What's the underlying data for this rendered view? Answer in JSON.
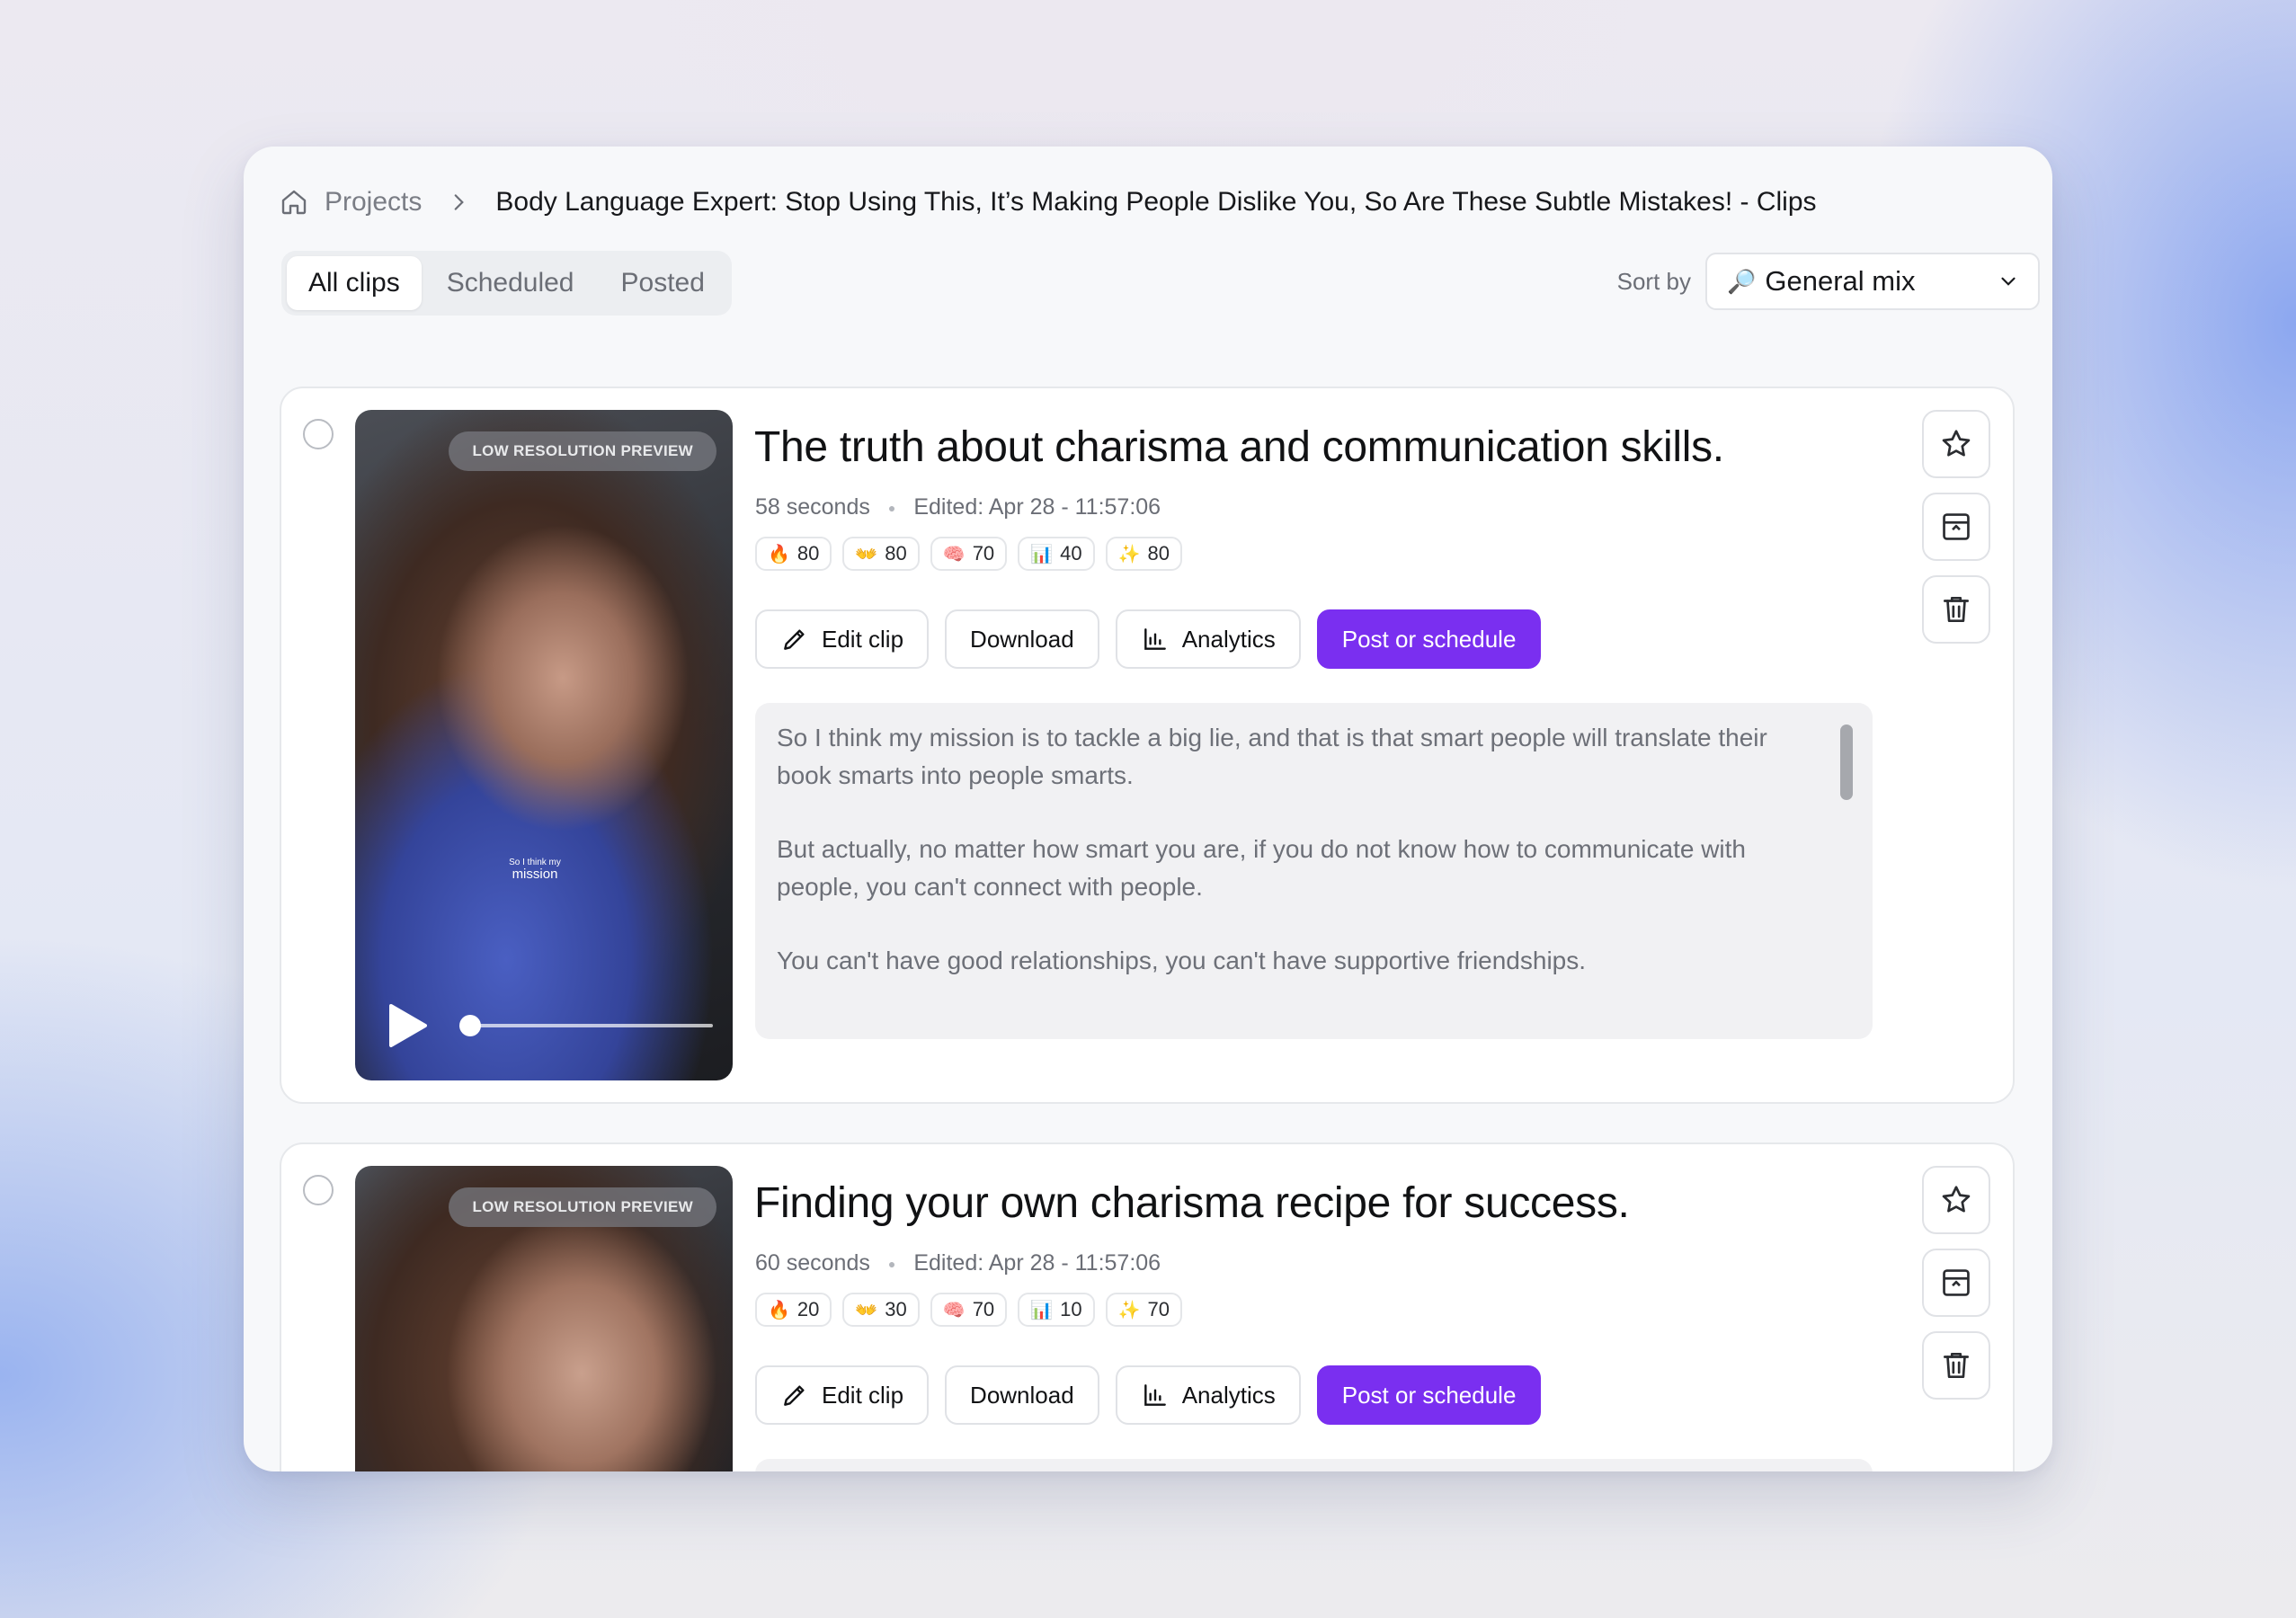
{
  "breadcrumb": {
    "home_icon": "home-icon",
    "projects": "Projects",
    "current": "Body Language Expert: Stop Using This, It’s Making People Dislike You, So Are These Subtle Mistakes! - Clips"
  },
  "tabs": [
    {
      "label": "All clips",
      "active": true
    },
    {
      "label": "Scheduled",
      "active": false
    },
    {
      "label": "Posted",
      "active": false
    }
  ],
  "sort": {
    "label": "Sort by",
    "icon": "🔎",
    "value": "General mix"
  },
  "accent_color": "#7a2ff0",
  "actions": {
    "edit": "Edit clip",
    "download": "Download",
    "analytics": "Analytics",
    "post": "Post or schedule"
  },
  "clips": [
    {
      "title": "The truth about charisma and communication skills.",
      "duration": "58 seconds",
      "edited": "Edited: Apr 28 - 11:57:06",
      "preview_label": "LOW RESOLUTION PREVIEW",
      "caption_small": "So I think my",
      "caption_big": "mission",
      "playback_progress": 0.0,
      "scores": [
        {
          "icon": "🔥",
          "value": "80"
        },
        {
          "icon": "👐",
          "value": "80"
        },
        {
          "icon": "🧠",
          "value": "70"
        },
        {
          "icon": "📊",
          "value": "40"
        },
        {
          "icon": "✨",
          "value": "80"
        }
      ],
      "transcript": [
        "So I think my mission is to tackle a big lie, and that is that smart people will translate their book smarts into people smarts.",
        "But actually, no matter how smart you are, if you do not know how to communicate with people, you can't connect with people.",
        "You can't have good relationships, you can't have supportive friendships."
      ]
    },
    {
      "title": "Finding your own charisma recipe for success.",
      "duration": "60 seconds",
      "edited": "Edited: Apr 28 - 11:57:06",
      "preview_label": "LOW RESOLUTION PREVIEW",
      "scores": [
        {
          "icon": "🔥",
          "value": "20"
        },
        {
          "icon": "👐",
          "value": "30"
        },
        {
          "icon": "🧠",
          "value": "70"
        },
        {
          "icon": "📊",
          "value": "10"
        },
        {
          "icon": "✨",
          "value": "70"
        }
      ]
    }
  ]
}
